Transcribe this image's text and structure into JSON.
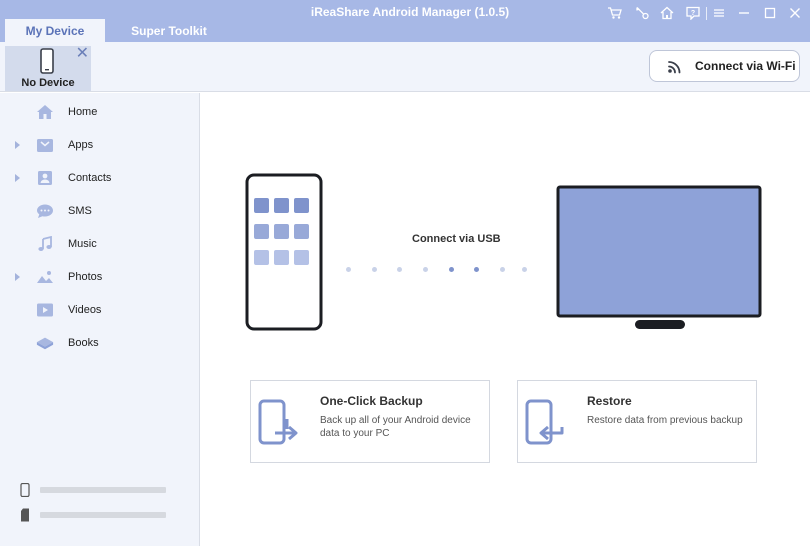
{
  "app": {
    "title": "iReaShare Android Manager (1.0.5)"
  },
  "tabs": [
    {
      "label": "My Device",
      "active": true
    },
    {
      "label": "Super Toolkit",
      "active": false
    }
  ],
  "window_controls": [
    "cart-icon",
    "key-icon",
    "home-icon",
    "feedback-icon",
    "menu-icon",
    "minimize-icon",
    "maximize-icon",
    "close-icon"
  ],
  "device": {
    "label": "No Device"
  },
  "wifi_button": {
    "label": "Connect via Wi-Fi"
  },
  "sidebar": {
    "items": [
      {
        "label": "Home",
        "icon": "home-icon",
        "expandable": false
      },
      {
        "label": "Apps",
        "icon": "apps-icon",
        "expandable": true
      },
      {
        "label": "Contacts",
        "icon": "contacts-icon",
        "expandable": true
      },
      {
        "label": "SMS",
        "icon": "sms-icon",
        "expandable": false
      },
      {
        "label": "Music",
        "icon": "music-icon",
        "expandable": false
      },
      {
        "label": "Photos",
        "icon": "photos-icon",
        "expandable": true
      },
      {
        "label": "Videos",
        "icon": "videos-icon",
        "expandable": false
      },
      {
        "label": "Books",
        "icon": "books-icon",
        "expandable": false
      }
    ],
    "storage": [
      "phone-storage-icon",
      "sd-card-icon"
    ]
  },
  "main": {
    "usb_label": "Connect via USB",
    "cards": [
      {
        "title": "One-Click Backup",
        "desc": "Back up all of your Android device data to your PC",
        "icon": "backup-icon"
      },
      {
        "title": "Restore",
        "desc": "Restore data from previous backup",
        "icon": "restore-icon"
      }
    ]
  },
  "colors": {
    "accent": "#a7b8e6",
    "panel": "#f1f4fb",
    "icon": "#8ea2d8",
    "monitor_screen": "#8ea2d8"
  }
}
